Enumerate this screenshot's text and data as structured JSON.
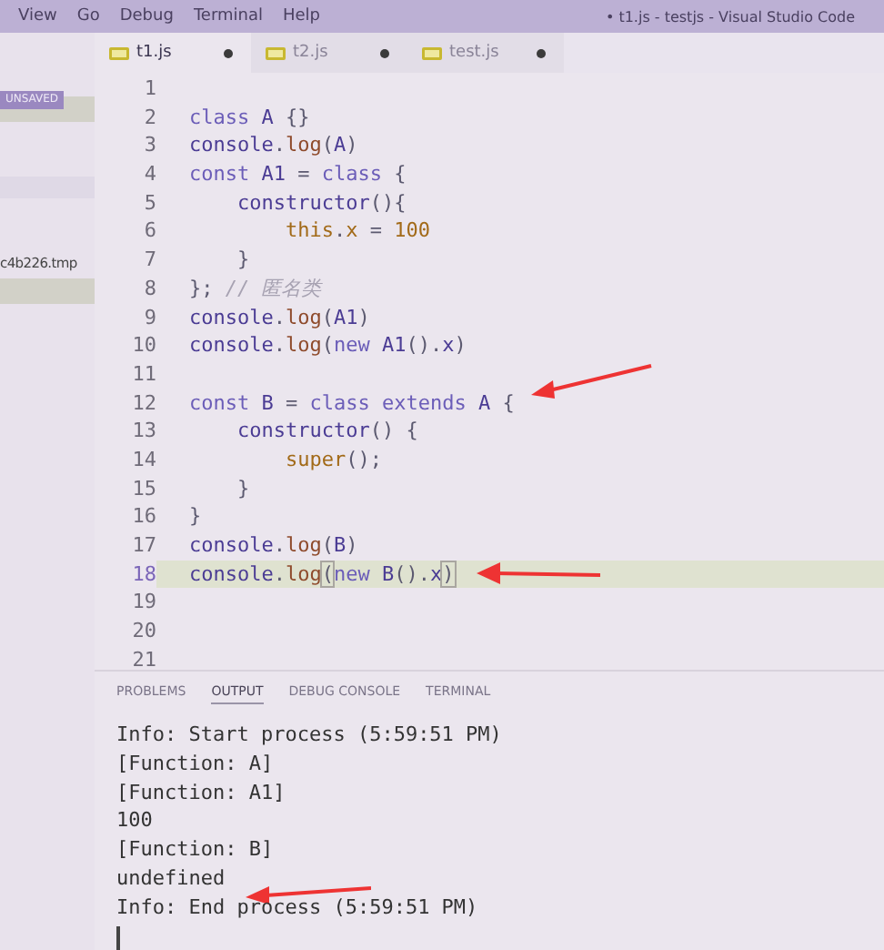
{
  "menu": [
    "View",
    "Go",
    "Debug",
    "Terminal",
    "Help"
  ],
  "window": {
    "title": "• t1.js - testjs - Visual Studio Code"
  },
  "tabs": [
    {
      "label": "t1.js",
      "selected": true,
      "dirty": true
    },
    {
      "label": "t2.js",
      "selected": false,
      "dirty": true
    },
    {
      "label": "test.js",
      "selected": false,
      "dirty": true
    }
  ],
  "sidebar": {
    "items": [
      {
        "kind": "badge",
        "label": "UNSAVED"
      },
      {
        "kind": "highlight"
      },
      {
        "kind": "gap"
      },
      {
        "kind": "hover"
      },
      {
        "kind": "gap"
      },
      {
        "kind": "file",
        "label": "c4b226.tmp"
      },
      {
        "kind": "highlight"
      }
    ]
  },
  "code": [
    {
      "number": "1",
      "current": false
    },
    {
      "number": "2",
      "current": false,
      "tokens": [
        {
          "kind": "k",
          "s": "class "
        },
        {
          "kind": "v",
          "s": "A "
        },
        {
          "kind": "p",
          "s": "{}"
        }
      ]
    },
    {
      "number": "3",
      "current": false,
      "tokens": [
        {
          "kind": "v",
          "s": "console"
        },
        {
          "kind": "p",
          "s": "."
        },
        {
          "kind": "f",
          "s": "log"
        },
        {
          "kind": "p",
          "s": "("
        },
        {
          "kind": "v",
          "s": "A"
        },
        {
          "kind": "p",
          "s": ")"
        }
      ]
    },
    {
      "number": "4",
      "current": false,
      "tokens": [
        {
          "kind": "k",
          "s": "const "
        },
        {
          "kind": "v",
          "s": "A1 "
        },
        {
          "kind": "p",
          "s": "= "
        },
        {
          "kind": "k",
          "s": "class "
        },
        {
          "kind": "p",
          "s": "{"
        }
      ]
    },
    {
      "number": "5",
      "current": false,
      "tokens": [
        {
          "kind": "v",
          "s": "    constructor"
        },
        {
          "kind": "p",
          "s": "(){"
        }
      ]
    },
    {
      "number": "6",
      "current": false,
      "tokens": [
        {
          "kind": "n",
          "s": "        this"
        },
        {
          "kind": "p",
          "s": "."
        },
        {
          "kind": "n",
          "s": "x"
        },
        {
          "kind": "p",
          "s": " = "
        },
        {
          "kind": "n",
          "s": "100"
        }
      ]
    },
    {
      "number": "7",
      "current": false,
      "tokens": [
        {
          "kind": "p",
          "s": "    }"
        }
      ]
    },
    {
      "number": "8",
      "current": false,
      "tokens": [
        {
          "kind": "p",
          "s": "}; "
        },
        {
          "kind": "c",
          "s": "// 匿名类"
        }
      ]
    },
    {
      "number": "9",
      "current": false,
      "tokens": [
        {
          "kind": "v",
          "s": "console"
        },
        {
          "kind": "p",
          "s": "."
        },
        {
          "kind": "f",
          "s": "log"
        },
        {
          "kind": "p",
          "s": "("
        },
        {
          "kind": "v",
          "s": "A1"
        },
        {
          "kind": "p",
          "s": ")"
        }
      ]
    },
    {
      "number": "10",
      "current": false,
      "tokens": [
        {
          "kind": "v",
          "s": "console"
        },
        {
          "kind": "p",
          "s": "."
        },
        {
          "kind": "f",
          "s": "log"
        },
        {
          "kind": "p",
          "s": "("
        },
        {
          "kind": "k",
          "s": "new "
        },
        {
          "kind": "v",
          "s": "A1"
        },
        {
          "kind": "p",
          "s": "()."
        },
        {
          "kind": "v",
          "s": "x"
        },
        {
          "kind": "p",
          "s": ")"
        }
      ]
    },
    {
      "number": "11",
      "current": false
    },
    {
      "number": "12",
      "current": false,
      "arrow": true,
      "tokens": [
        {
          "kind": "k",
          "s": "const "
        },
        {
          "kind": "v",
          "s": "B "
        },
        {
          "kind": "p",
          "s": "= "
        },
        {
          "kind": "k",
          "s": "class "
        },
        {
          "kind": "k",
          "s": "extends "
        },
        {
          "kind": "v",
          "s": "A "
        },
        {
          "kind": "p",
          "s": "{"
        }
      ]
    },
    {
      "number": "13",
      "current": false,
      "tokens": [
        {
          "kind": "v",
          "s": "    constructor"
        },
        {
          "kind": "p",
          "s": "() {"
        }
      ]
    },
    {
      "number": "14",
      "current": false,
      "tokens": [
        {
          "kind": "n",
          "s": "        super"
        },
        {
          "kind": "p",
          "s": "();"
        }
      ]
    },
    {
      "number": "15",
      "current": false,
      "tokens": [
        {
          "kind": "p",
          "s": "    }"
        }
      ]
    },
    {
      "number": "16",
      "current": false,
      "tokens": [
        {
          "kind": "p",
          "s": "}"
        }
      ]
    },
    {
      "number": "17",
      "current": false,
      "tokens": [
        {
          "kind": "v",
          "s": "console"
        },
        {
          "kind": "p",
          "s": "."
        },
        {
          "kind": "f",
          "s": "log"
        },
        {
          "kind": "p",
          "s": "("
        },
        {
          "kind": "v",
          "s": "B"
        },
        {
          "kind": "p",
          "s": ")"
        }
      ]
    },
    {
      "number": "18",
      "current": true,
      "arrow": true,
      "tokens": [
        {
          "kind": "v",
          "s": "console"
        },
        {
          "kind": "p",
          "s": "."
        },
        {
          "kind": "f",
          "s": "log"
        },
        {
          "kind": "b",
          "s": "("
        },
        {
          "kind": "k",
          "s": "new "
        },
        {
          "kind": "v",
          "s": "B"
        },
        {
          "kind": "p",
          "s": "()."
        },
        {
          "kind": "v",
          "s": "x"
        },
        {
          "kind": "b",
          "s": ")"
        }
      ]
    },
    {
      "number": "19",
      "current": false
    },
    {
      "number": "20",
      "current": false
    },
    {
      "number": "21",
      "current": false
    }
  ],
  "panel": {
    "tabs": [
      {
        "label": "PROBLEMS",
        "selected": false
      },
      {
        "label": "OUTPUT",
        "selected": true
      },
      {
        "label": "DEBUG CONSOLE",
        "selected": false
      },
      {
        "label": "TERMINAL",
        "selected": false
      }
    ],
    "output": [
      {
        "text": "Info: Start process (5:59:51 PM)"
      },
      {
        "text": "[Function: A]"
      },
      {
        "text": "[Function: A1]"
      },
      {
        "text": "100"
      },
      {
        "text": "[Function: B]"
      },
      {
        "text": "undefined",
        "arrow": true
      },
      {
        "text": "Info: End process (5:59:51 PM)"
      }
    ]
  }
}
